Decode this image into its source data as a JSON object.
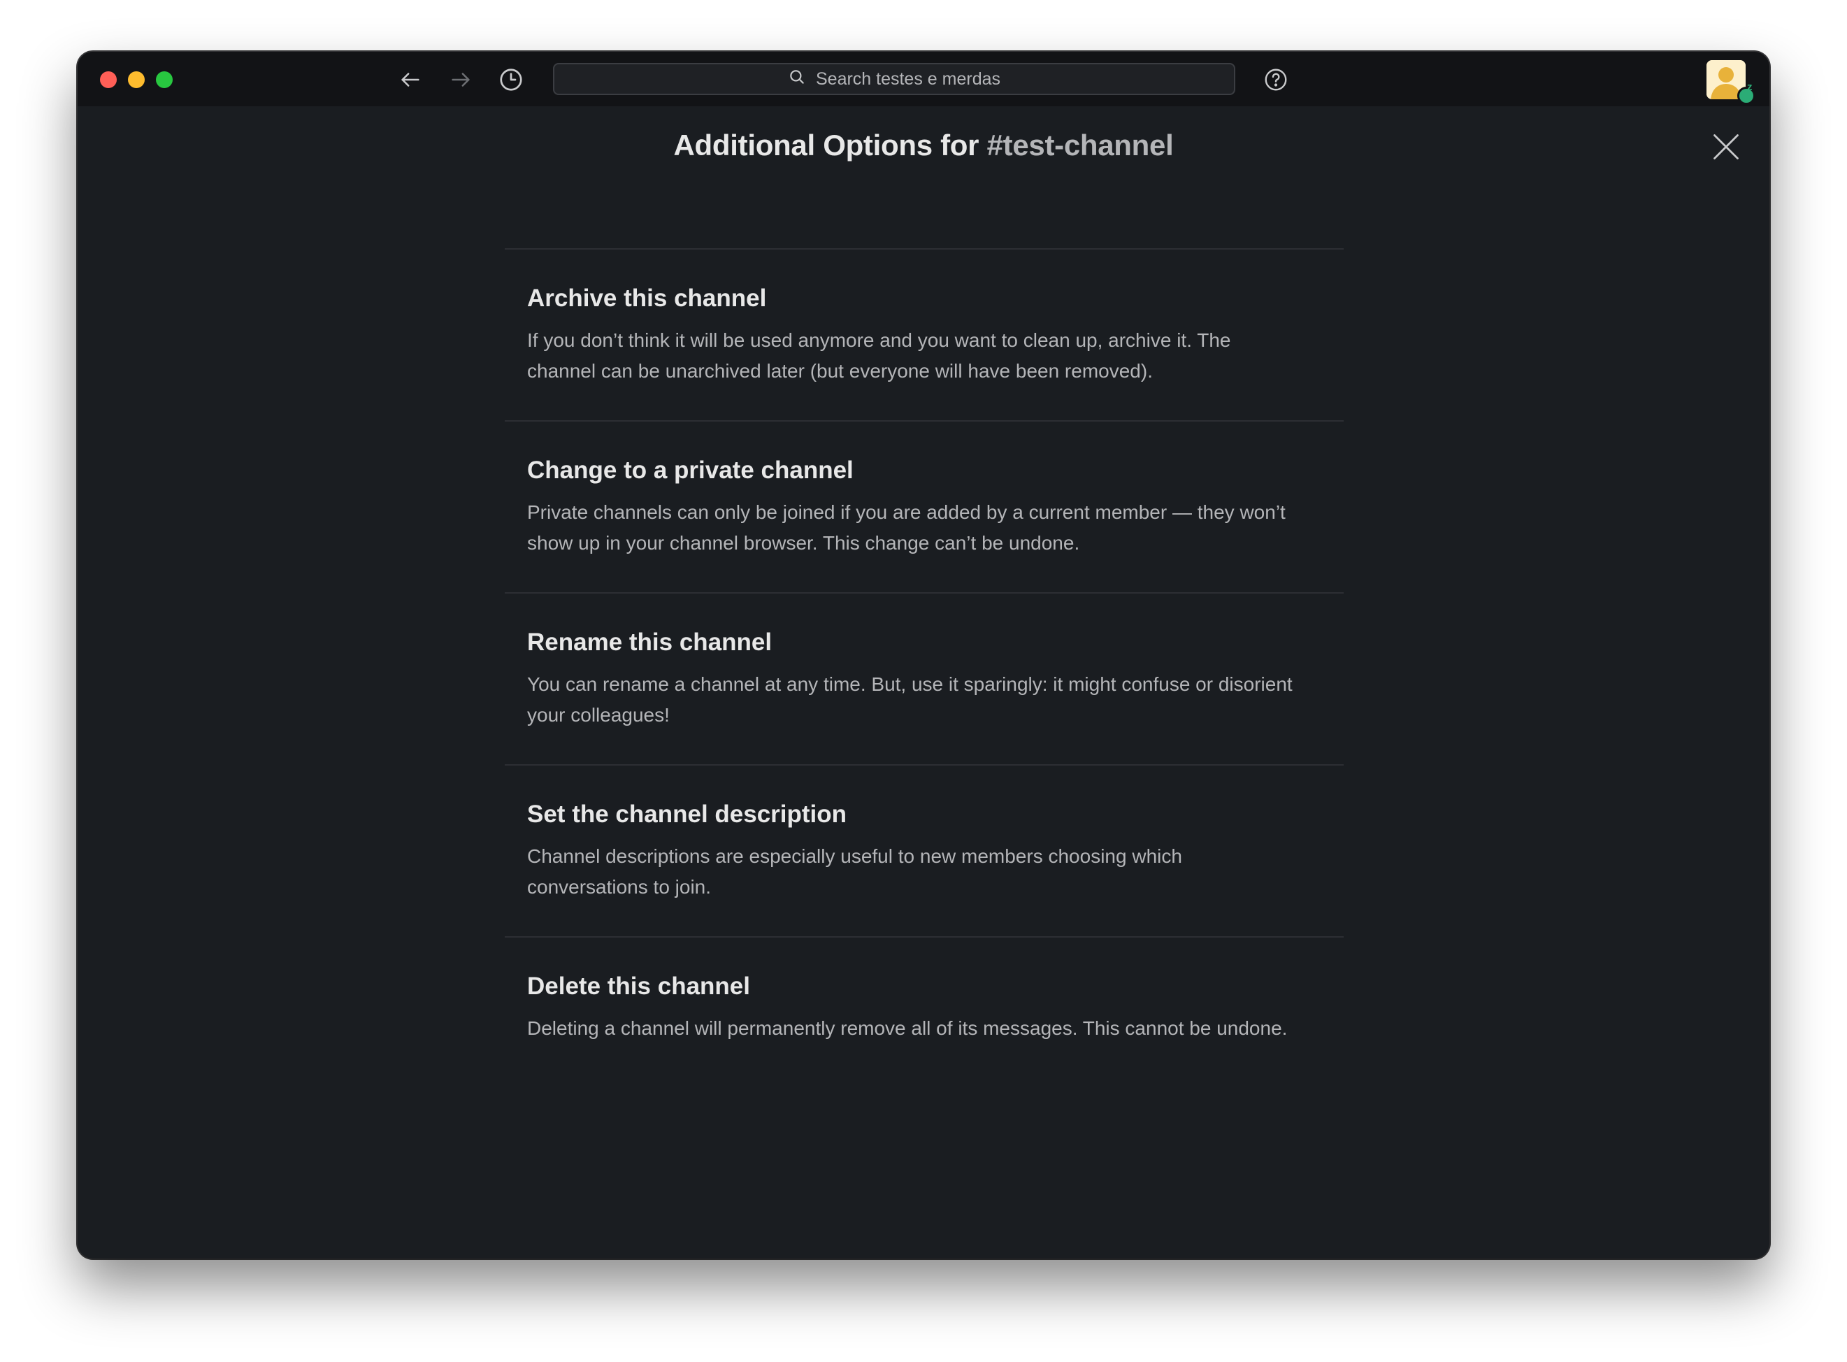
{
  "search": {
    "placeholder": "Search testes e merdas"
  },
  "modal": {
    "title_prefix": "Additional Options for",
    "channel_name": "#test-channel"
  },
  "options": [
    {
      "title": "Archive this channel",
      "description": "If you don’t think it will be used anymore and you want to clean up, archive it. The channel can be unarchived later (but everyone will have been removed)."
    },
    {
      "title": "Change to a private channel",
      "description": "Private channels can only be joined if you are added by a current member — they won’t show up in your channel browser. This change can’t be undone."
    },
    {
      "title": "Rename this channel",
      "description": "You can rename a channel at any time. But, use it sparingly: it might confuse or disorient your colleagues!"
    },
    {
      "title": "Set the channel description",
      "description": "Channel descriptions are especially useful to new members choosing which conversations to join."
    },
    {
      "title": "Delete this channel",
      "description": "Deleting a channel will permanently remove all of its messages. This cannot be undone."
    }
  ],
  "user": {
    "status_letter": "z"
  },
  "colors": {
    "background": "#1a1d21",
    "titlebar": "#121316",
    "text_primary": "#e8e8e8",
    "text_secondary": "#b4b5b8",
    "divider": "#2c2e33",
    "status_active": "#2bac76"
  },
  "icons": [
    "back-arrow-icon",
    "forward-arrow-icon",
    "history-icon",
    "search-icon",
    "help-icon",
    "close-icon"
  ]
}
